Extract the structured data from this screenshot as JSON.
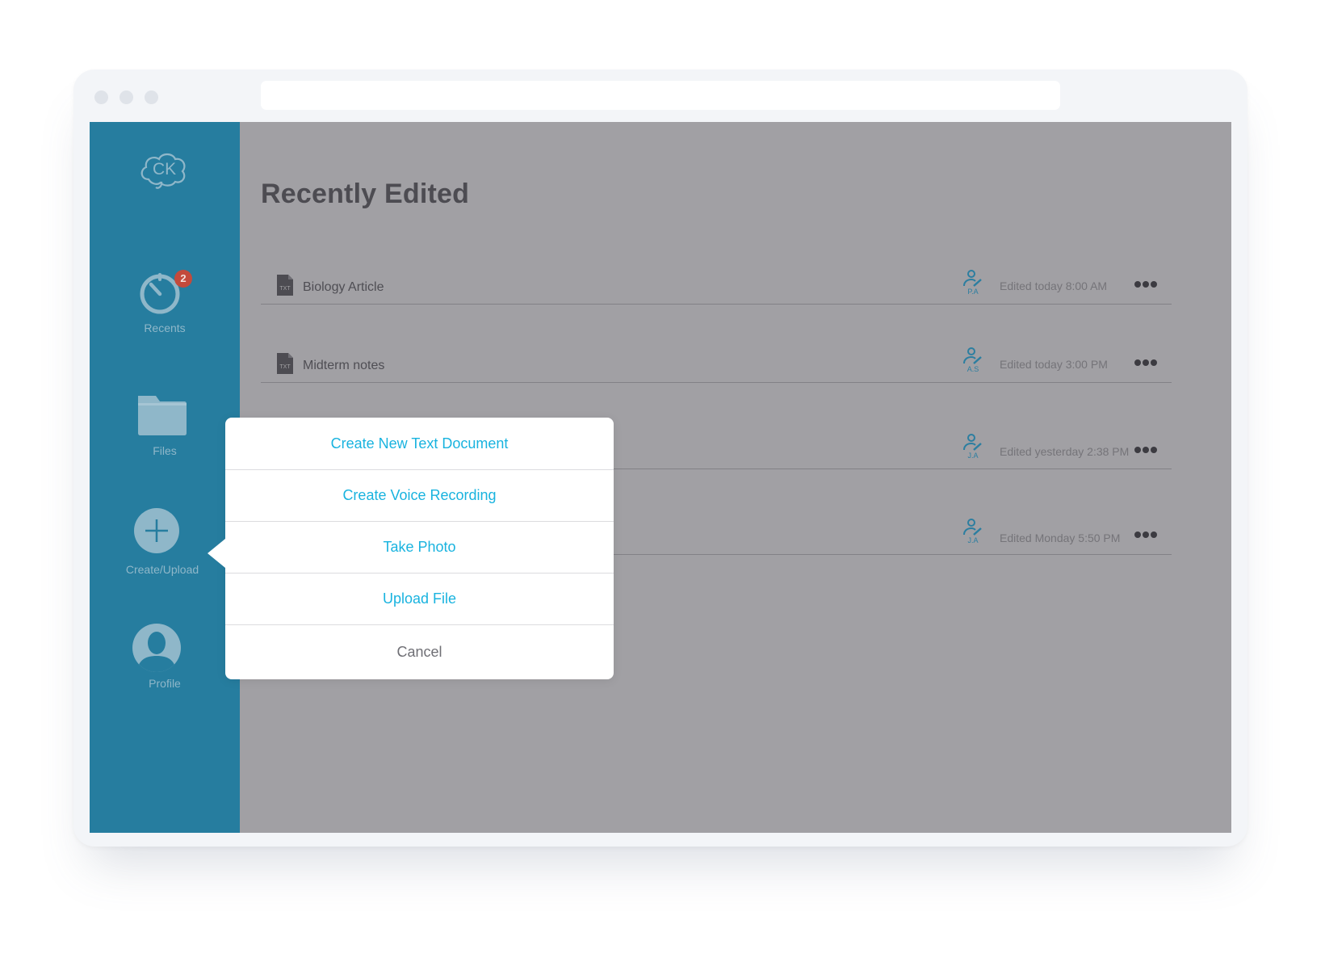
{
  "sidebar": {
    "logo_text": "CK",
    "items": [
      {
        "label": "Recents",
        "badge": "2"
      },
      {
        "label": "Files"
      },
      {
        "label": "Create/Upload"
      },
      {
        "label": "Profile"
      }
    ]
  },
  "main": {
    "title": "Recently Edited",
    "files": [
      {
        "name": "Biology Article",
        "type": "TXT",
        "user": "P.A",
        "edited": "Edited today 8:00 AM"
      },
      {
        "name": "Midterm notes",
        "type": "TXT",
        "user": "A.S",
        "edited": "Edited today 3:00 PM"
      },
      {
        "name": "",
        "type": "",
        "user": "J.A",
        "edited": "Edited yesterday  2:38 PM"
      },
      {
        "name": "",
        "type": "",
        "user": "J.A",
        "edited": "Edited Monday 5:50 PM"
      }
    ]
  },
  "popover": {
    "items": [
      "Create New Text Document",
      "Create Voice Recording",
      "Take Photo",
      "Upload File",
      "Cancel"
    ]
  },
  "colors": {
    "sidebar": "#267d9f",
    "overlay": "#a1a0a4",
    "accent": "#19b3df",
    "badge": "#c34a3c"
  }
}
